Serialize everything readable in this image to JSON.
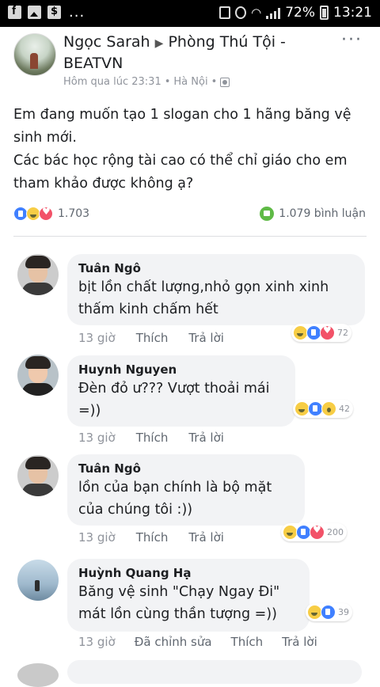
{
  "status_bar": {
    "battery": "72%",
    "time": "13:21",
    "more_indicator": "..."
  },
  "post": {
    "author": "Ngọc Sarah",
    "group": "Phòng Thú Tội - BEATVN",
    "time": "Hôm qua lúc 23:31",
    "location": "Hà Nội",
    "text_lines": [
      "Em đang muốn tạo 1 slogan cho 1 hãng băng vệ sinh mới.",
      "Các bác học rộng tài cao có thể chỉ giáo cho em tham khảo được không ạ?"
    ],
    "reaction_count": "1.703",
    "comment_count": "1.079 bình luận",
    "reaction_icons": [
      "like",
      "haha",
      "love"
    ],
    "more_label": "···"
  },
  "comments": [
    {
      "name": "Tuân Ngô",
      "text": "bịt lồn chất lượng,nhỏ gọn xinh xinh thấm kinh chấm hết",
      "time": "13 giờ",
      "like_label": "Thích",
      "reply_label": "Trả lời",
      "reactions": [
        "haha",
        "like",
        "love"
      ],
      "reaction_count": "72"
    },
    {
      "name": "Huynh Nguyen",
      "text": "Đèn đỏ ư??? Vượt thoải mái =))",
      "time": "13 giờ",
      "like_label": "Thích",
      "reply_label": "Trả lời",
      "reactions": [
        "haha",
        "like",
        "wow"
      ],
      "reaction_count": "42"
    },
    {
      "name": "Tuân Ngô",
      "text": "lồn của bạn chính là bộ mặt của chúng tôi :))",
      "time": "13 giờ",
      "like_label": "Thích",
      "reply_label": "Trả lời",
      "reactions": [
        "haha",
        "like",
        "love"
      ],
      "reaction_count": "200"
    },
    {
      "name": "Huỳnh Quang Hạ",
      "text_lines": [
        "Băng vệ sinh \"Chạy Ngay Đi\"",
        "mát lồn cùng thần tượng =))"
      ],
      "time": "13 giờ",
      "edited_label": "Đã chỉnh sửa",
      "like_label": "Thích",
      "reply_label": "Trả lời",
      "reactions": [
        "haha",
        "like"
      ],
      "reaction_count": "39"
    }
  ]
}
